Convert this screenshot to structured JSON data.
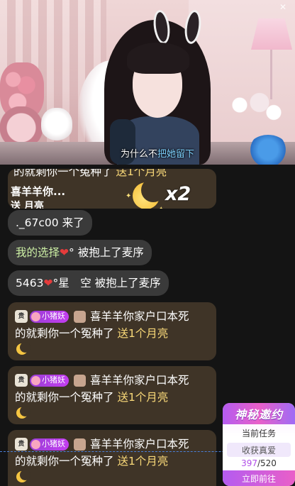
{
  "video": {
    "subtitle_prefix": "为什么不",
    "subtitle_highlight": "把她留",
    "subtitle_suffix": "下",
    "close_glyph": "✕"
  },
  "gift_banner": {
    "truncated_line_a": "的就剩你一个冤种了 ",
    "truncated_line_b": "送1个月亮",
    "sender_name": "喜羊羊你...",
    "sent_text": "送 月亮",
    "multiplier": "x2"
  },
  "messages": [
    {
      "type": "plain",
      "text": "._67c00 来了"
    },
    {
      "type": "plain",
      "prefix": "我的选择",
      "heart": "❤",
      "suffix": "° 被抱上了麦序"
    },
    {
      "type": "plain",
      "prefix": "5463",
      "heart": "❤",
      "suffix": "°星　空 被抱上了麦序"
    }
  ],
  "gift_cards": [
    {
      "level": "贵",
      "fan_badge": "小猪妖",
      "line1": "喜羊羊你家户口本死",
      "line2a": "的就剩你一个冤种了 ",
      "line2b": "送1个月亮"
    },
    {
      "level": "贵",
      "fan_badge": "小猪妖",
      "line1": "喜羊羊你家户口本死",
      "line2a": "的就剩你一个冤种了 ",
      "line2b": "送1个月亮"
    },
    {
      "level": "贵",
      "fan_badge": "小猪妖",
      "line1": "喜羊羊你家户口本死",
      "line2a": "的就剩你一个冤种了 ",
      "line2b": "送1个月亮"
    }
  ],
  "activity": {
    "title": "神秘邀约",
    "task_label": "当前任务",
    "task_name": "收获真爱",
    "progress_current": "397",
    "progress_total": "/520",
    "cta": "立即前往"
  },
  "colors": {
    "highlight": "#f8d878",
    "heart": "#e53b3b",
    "fan_badge": "#b23fe3",
    "accent": "#b45cf0"
  }
}
